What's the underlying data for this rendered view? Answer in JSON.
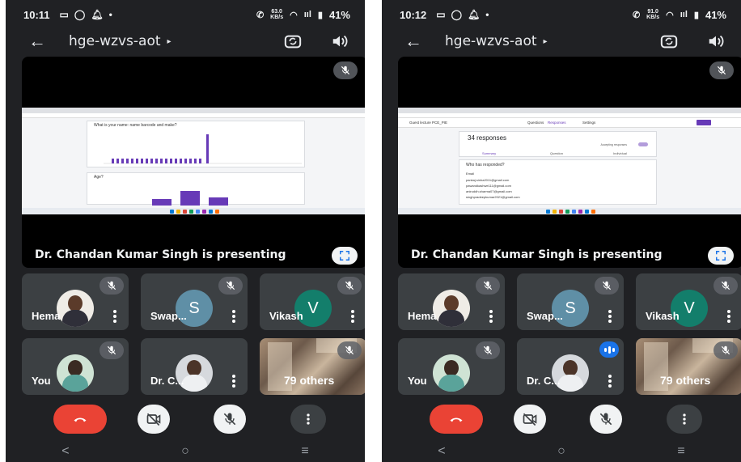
{
  "left": {
    "status": {
      "time": "10:11",
      "netspeed_value": "63.0",
      "netspeed_unit": "KB/s",
      "signal": "ııl",
      "battery": "41%"
    },
    "appbar": {
      "title": "hge-wzvs-aot",
      "caret": "▸"
    },
    "stage": {
      "caption": "Dr. Chandan Kumar Singh is presenting"
    },
    "tiles": [
      {
        "name": "Hema",
        "avatar_type": "photo"
      },
      {
        "name": "Swap...",
        "avatar_letter": "S",
        "avatar_color": "#5f8fa6"
      },
      {
        "name": "Vikash",
        "avatar_letter": "V",
        "avatar_color": "#137e6b"
      },
      {
        "name": "You",
        "avatar_type": "photo"
      },
      {
        "name": "Dr. C...",
        "avatar_type": "photo"
      },
      {
        "name": "79 others"
      }
    ]
  },
  "right": {
    "status": {
      "time": "10:12",
      "netspeed_value": "91.0",
      "netspeed_unit": "KB/s",
      "signal": "ııl",
      "battery": "41%"
    },
    "appbar": {
      "title": "hge-wzvs-aot",
      "caret": "▸"
    },
    "stage": {
      "caption": "Dr. Chandan Kumar Singh is presenting"
    },
    "tiles": [
      {
        "name": "Hema",
        "avatar_type": "photo"
      },
      {
        "name": "Swap...",
        "avatar_letter": "S",
        "avatar_color": "#5f8fa6"
      },
      {
        "name": "Vikash",
        "avatar_letter": "V",
        "avatar_color": "#137e6b"
      },
      {
        "name": "You",
        "avatar_type": "photo"
      },
      {
        "name": "Dr. C...",
        "avatar_type": "photo",
        "speaking": true
      },
      {
        "name": "79 others"
      }
    ]
  },
  "shared_left": {
    "question1": "What is your name: name barcode and make?",
    "question2": "Age?"
  },
  "shared_right": {
    "form_title": "Guest lecture PCE_PIE",
    "tab_questions": "Questions",
    "tab_responses": "Responses",
    "tab_settings": "Settings",
    "responses": "34 responses",
    "accepting": "Accepting responses",
    "subtab_summary": "Summary",
    "subtab_question": "Question",
    "subtab_individual": "Individual",
    "who": "Who has responded?",
    "email_label": "Email",
    "emails": [
      "pankaj.sinha2011@gmail.com",
      "pawandkashwe111@gmail.com",
      "aniruddh.sharma07@gmail.com",
      "singhpradeepkumar2021@gmail.com"
    ]
  },
  "colors": {
    "end_call": "#ea4335",
    "bg": "#202124",
    "tile": "#3c4043",
    "accent": "#1a73e8"
  },
  "icons": [
    "back-arrow-icon",
    "camera-flip-icon",
    "speaker-icon",
    "mic-off-icon",
    "fullscreen-icon",
    "call-end-icon",
    "video-off-icon",
    "more-vert-icon"
  ]
}
